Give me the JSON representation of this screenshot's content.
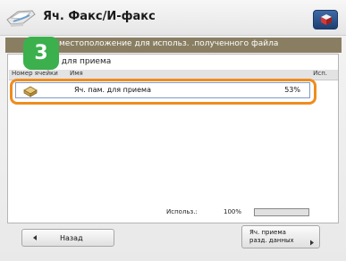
{
  "header": {
    "title": "Яч. Факс/И-факс",
    "home_icon": "home-cube-icon",
    "fax_icon": "fax-icon"
  },
  "step_badge": "3",
  "instruction": "местоположение для использ. .полученного файла",
  "panel": {
    "title": ". для приема",
    "columns": {
      "number": "Номер ячейки",
      "name": "Имя",
      "usage": "Исп."
    },
    "rows": [
      {
        "icon": "inbox-icon",
        "name": "Яч. пам. для приема",
        "percent": "53%"
      }
    ]
  },
  "usage": {
    "label": "Использ.:",
    "value": "100%",
    "fraction": 1.0
  },
  "buttons": {
    "back": "Назад",
    "split": "Яч. приема\nразд. данных"
  },
  "colors": {
    "accent_orange": "#f08c1e",
    "badge_green": "#3bb04d",
    "instruction_bar": "#8a7e62",
    "home_blue": "#1d3f72"
  }
}
